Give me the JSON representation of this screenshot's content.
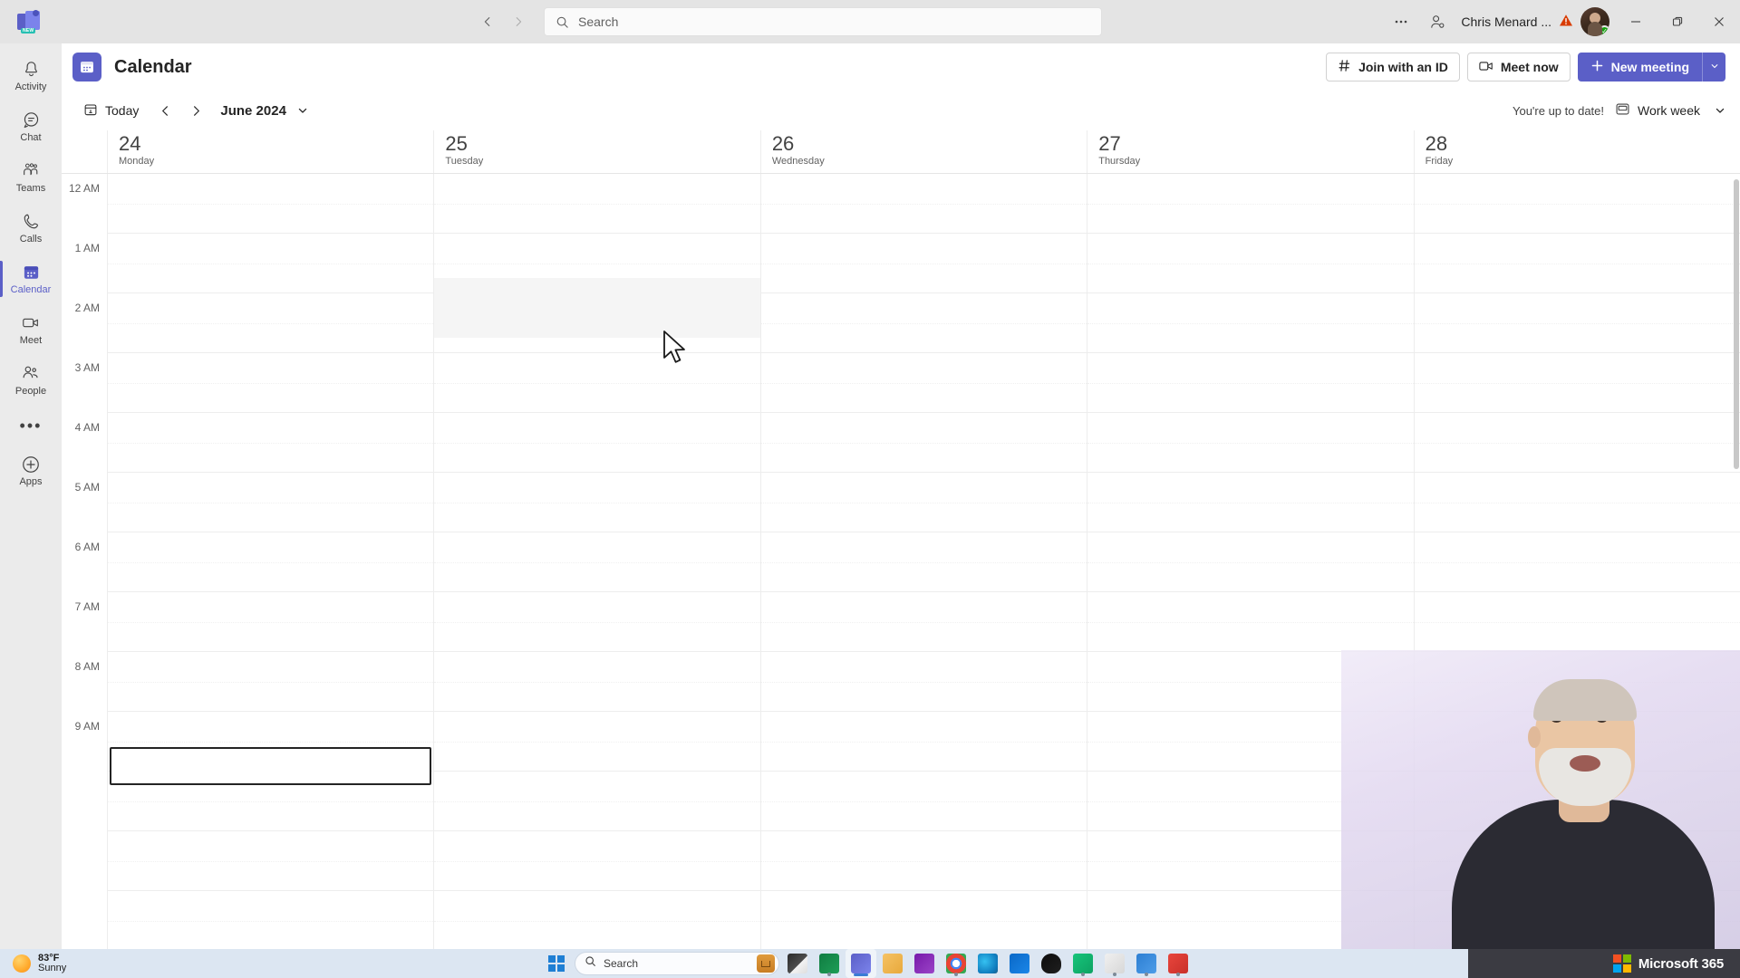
{
  "titlebar": {
    "app_logo": "teams-logo",
    "logo_badge": "NEW",
    "back_icon": "chevron-left-icon",
    "forward_icon": "chevron-right-icon",
    "search_placeholder": "Search",
    "search_icon": "search-icon",
    "more_icon": "ellipsis-icon",
    "people_icon": "add-people-icon",
    "account_name": "Chris Menard ...",
    "warning_icon": "warning-triangle-icon",
    "presence_status": "available",
    "minimize_label": "–",
    "maximize_label": "❐",
    "close_label": "✕"
  },
  "rail": {
    "items": [
      {
        "label": "Activity",
        "icon": "bell-icon",
        "active": false
      },
      {
        "label": "Chat",
        "icon": "chat-bubble-icon",
        "active": false
      },
      {
        "label": "Teams",
        "icon": "teams-people-icon",
        "active": false
      },
      {
        "label": "Calls",
        "icon": "phone-icon",
        "active": false
      },
      {
        "label": "Calendar",
        "icon": "calendar-icon",
        "active": true
      },
      {
        "label": "Meet",
        "icon": "video-camera-icon",
        "active": false
      },
      {
        "label": "People",
        "icon": "people-icon",
        "active": false
      }
    ],
    "more_label": "•••",
    "apps_label": "Apps",
    "apps_icon": "plus-circle-icon"
  },
  "app_header": {
    "title": "Calendar",
    "app_icon": "calendar-app-icon",
    "join_with_id": "Join with an ID",
    "join_icon": "hash-icon",
    "meet_now": "Meet now",
    "meet_icon": "video-camera-icon",
    "new_meeting": "New meeting",
    "new_meeting_icon": "plus-icon",
    "new_meeting_caret": "chevron-down-icon"
  },
  "cal_toolbar": {
    "today": "Today",
    "today_icon": "today-calendar-icon",
    "prev_icon": "chevron-left-icon",
    "next_icon": "chevron-right-icon",
    "month": "June 2024",
    "month_caret": "chevron-down-icon",
    "status": "You're up to date!",
    "view_icon": "view-layout-icon",
    "view": "Work week",
    "view_caret": "chevron-down-icon"
  },
  "calendar": {
    "days": [
      {
        "num": "24",
        "name": "Monday"
      },
      {
        "num": "25",
        "name": "Tuesday"
      },
      {
        "num": "26",
        "name": "Wednesday"
      },
      {
        "num": "27",
        "name": "Thursday"
      },
      {
        "num": "28",
        "name": "Friday"
      }
    ],
    "times": [
      "12 AM",
      "1 AM",
      "2 AM",
      "3 AM",
      "4 AM",
      "5 AM",
      "6 AM",
      "7 AM",
      "8 AM",
      "9 AM"
    ],
    "events": [],
    "selected_slot": {
      "day_index": 0,
      "label": ""
    },
    "hover_slot": {
      "day_index": 1
    }
  },
  "taskbar": {
    "weather_temp": "83°F",
    "weather_cond": "Sunny",
    "weather_icon": "sun-icon",
    "start_icon": "windows-start-icon",
    "search_label": "Search",
    "search_icon": "search-icon",
    "copilot_icon": "briefcase-icon",
    "apps": [
      {
        "name": "file-explorer-dark-icon",
        "running": false
      },
      {
        "name": "excel-icon",
        "running": true
      },
      {
        "name": "teams-icon",
        "running": true,
        "active": true
      },
      {
        "name": "folder-icon",
        "running": false
      },
      {
        "name": "onenote-icon",
        "running": false
      },
      {
        "name": "chrome-icon",
        "running": true
      },
      {
        "name": "edge-icon",
        "running": false
      },
      {
        "name": "outlook-icon",
        "running": false
      },
      {
        "name": "alienware-icon",
        "running": false
      },
      {
        "name": "camtasia-icon",
        "running": true
      },
      {
        "name": "snagit-editor-icon",
        "running": true
      },
      {
        "name": "snagit-icon",
        "running": true
      },
      {
        "name": "camtasia-red-icon",
        "running": true
      }
    ],
    "brand": "Microsoft 365",
    "brand_icon": "microsoft-logo-icon"
  }
}
